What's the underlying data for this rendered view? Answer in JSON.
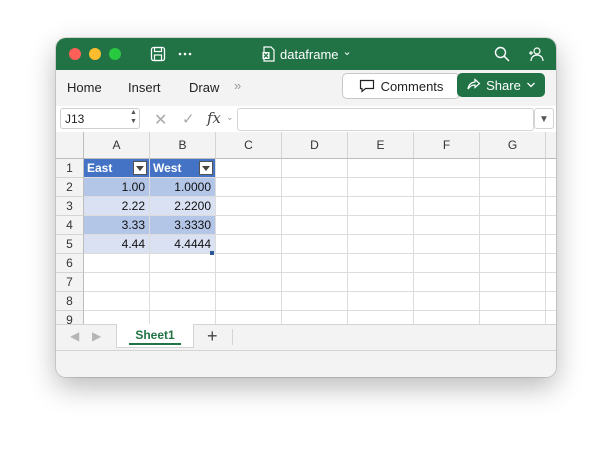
{
  "window": {
    "title": "dataframe",
    "title_chevron": "⌄"
  },
  "ribbon": {
    "tabs": [
      "Home",
      "Insert",
      "Draw"
    ],
    "more": "»",
    "comments_label": "Comments",
    "share_label": "Share"
  },
  "formula_bar": {
    "name_box": "J13",
    "fx_label": "fx",
    "formula": ""
  },
  "grid": {
    "columns": [
      "A",
      "B",
      "C",
      "D",
      "E",
      "F",
      "G"
    ],
    "rows": [
      "1",
      "2",
      "3",
      "4",
      "5",
      "6",
      "7",
      "8",
      "9"
    ],
    "table": {
      "headers": [
        "East",
        "West"
      ],
      "rows": [
        [
          "1.00",
          "1.0000"
        ],
        [
          "2.22",
          "2.2200"
        ],
        [
          "3.33",
          "3.3330"
        ],
        [
          "4.44",
          "4.4444"
        ]
      ]
    }
  },
  "sheets": {
    "tabs": [
      "Sheet1"
    ],
    "active": "Sheet1",
    "add_label": "+"
  },
  "colors": {
    "app_green": "#217346",
    "table_header": "#4472c4",
    "band_dark": "#b4c6e7",
    "band_light": "#d9e1f2"
  }
}
